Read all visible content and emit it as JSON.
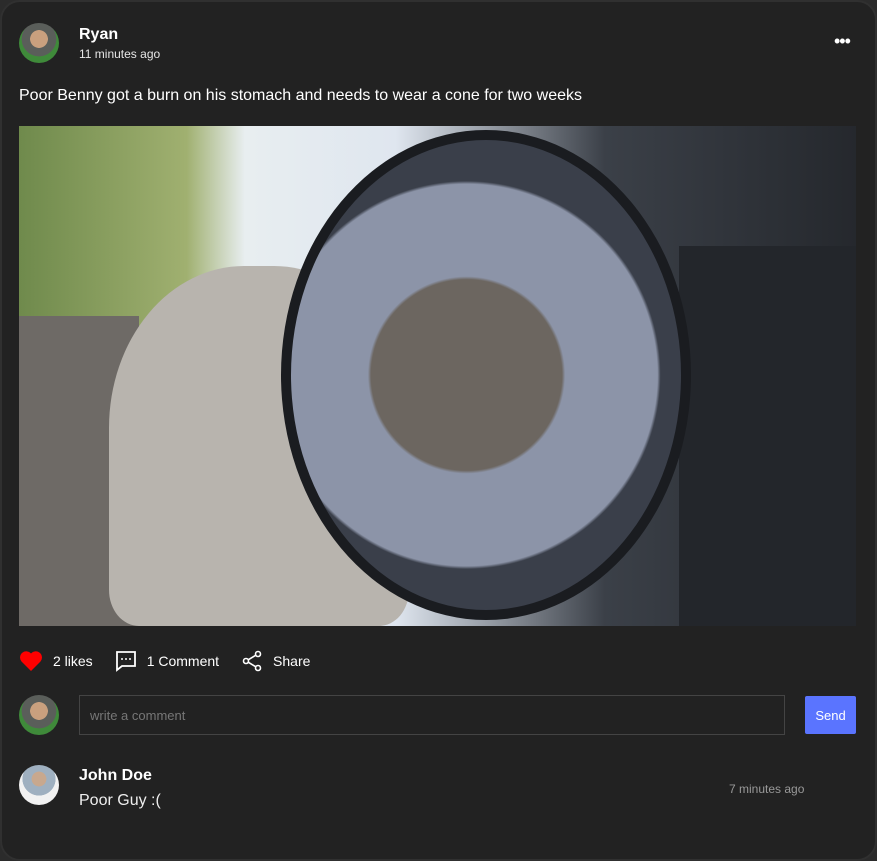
{
  "post": {
    "author": "Ryan",
    "time": "11 minutes ago",
    "text": "Poor Benny got a burn on his stomach and needs to wear a cone for two weeks",
    "menu_icon": "more-horizontal-icon"
  },
  "actions": {
    "likes": "2 likes",
    "comments": "1 Comment",
    "share": "Share",
    "like_color": "#ff0000"
  },
  "comment_form": {
    "placeholder": "write a comment",
    "send_label": "Send",
    "send_color": "#5a74ff"
  },
  "comments": [
    {
      "author": "John Doe",
      "text": "Poor Guy :(",
      "time": "7 minutes ago"
    }
  ]
}
